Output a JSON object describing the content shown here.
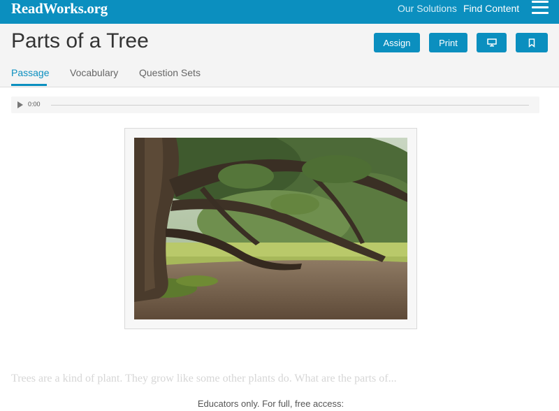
{
  "header": {
    "logo": "ReadWorks.org",
    "nav": [
      {
        "label": "Our Solutions"
      },
      {
        "label": "Find Content"
      }
    ]
  },
  "page": {
    "title": "Parts of a Tree",
    "buttons": {
      "assign": "Assign",
      "print": "Print"
    },
    "tabs": [
      {
        "label": "Passage",
        "active": true
      },
      {
        "label": "Vocabulary",
        "active": false
      },
      {
        "label": "Question Sets",
        "active": false
      }
    ]
  },
  "audio": {
    "time": "0:00"
  },
  "passage": {
    "preview": "Trees are a kind of plant. They grow like some other plants do. What are the parts of...",
    "access_notice": "Educators only. For full, free access:"
  },
  "colors": {
    "brand": "#0b8fbf",
    "title_bg": "#f4f4f4"
  }
}
